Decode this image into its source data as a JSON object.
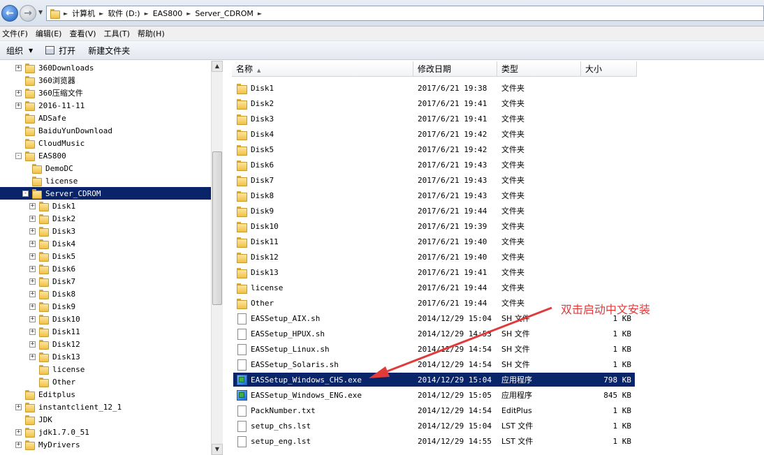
{
  "address": {
    "crumbs": [
      "计算机",
      "软件 (D:)",
      "EAS800",
      "Server_CDROM"
    ],
    "icons": {
      "back": "back-arrow-icon",
      "forward": "forward-arrow-icon"
    }
  },
  "menu": [
    "文件(F)",
    "编辑(E)",
    "查看(V)",
    "工具(T)",
    "帮助(H)"
  ],
  "toolbar": {
    "organize": "组织",
    "open": "打开",
    "new_folder": "新建文件夹"
  },
  "tree": {
    "items": [
      {
        "label": "360Downloads",
        "expander": "+",
        "level": 0
      },
      {
        "label": "360浏览器",
        "expander": "",
        "level": 0
      },
      {
        "label": "360压缩文件",
        "expander": "+",
        "level": 0
      },
      {
        "label": "2016-11-11",
        "expander": "+",
        "level": 0
      },
      {
        "label": "ADSafe",
        "expander": "",
        "level": 0
      },
      {
        "label": "BaiduYunDownload",
        "expander": "",
        "level": 0
      },
      {
        "label": "CloudMusic",
        "expander": "",
        "level": 0
      },
      {
        "label": "EAS800",
        "expander": "-",
        "level": 0
      },
      {
        "label": "DemoDC",
        "expander": "",
        "level": 1
      },
      {
        "label": "license",
        "expander": "",
        "level": 1
      },
      {
        "label": "Server_CDROM",
        "expander": "-",
        "level": 1,
        "selected": true
      },
      {
        "label": "Disk1",
        "expander": "+",
        "level": 2
      },
      {
        "label": "Disk2",
        "expander": "+",
        "level": 2
      },
      {
        "label": "Disk3",
        "expander": "+",
        "level": 2
      },
      {
        "label": "Disk4",
        "expander": "+",
        "level": 2
      },
      {
        "label": "Disk5",
        "expander": "+",
        "level": 2
      },
      {
        "label": "Disk6",
        "expander": "+",
        "level": 2
      },
      {
        "label": "Disk7",
        "expander": "+",
        "level": 2
      },
      {
        "label": "Disk8",
        "expander": "+",
        "level": 2
      },
      {
        "label": "Disk9",
        "expander": "+",
        "level": 2
      },
      {
        "label": "Disk10",
        "expander": "+",
        "level": 2
      },
      {
        "label": "Disk11",
        "expander": "+",
        "level": 2
      },
      {
        "label": "Disk12",
        "expander": "+",
        "level": 2
      },
      {
        "label": "Disk13",
        "expander": "+",
        "level": 2
      },
      {
        "label": "license",
        "expander": "",
        "level": 2
      },
      {
        "label": "Other",
        "expander": "",
        "level": 2
      },
      {
        "label": "Editplus",
        "expander": "",
        "level": 0
      },
      {
        "label": "instantclient_12_1",
        "expander": "+",
        "level": 0
      },
      {
        "label": "JDK",
        "expander": "",
        "level": 0
      },
      {
        "label": "jdk1.7.0_51",
        "expander": "+",
        "level": 0
      },
      {
        "label": "MyDrivers",
        "expander": "+",
        "level": 0
      }
    ]
  },
  "columns": {
    "name": "名称",
    "date": "修改日期",
    "type": "类型",
    "size": "大小"
  },
  "files": [
    {
      "name": "Disk1",
      "date": "2017/6/21 19:38",
      "type": "文件夹",
      "size": "",
      "icon": "folder-icon"
    },
    {
      "name": "Disk2",
      "date": "2017/6/21 19:41",
      "type": "文件夹",
      "size": "",
      "icon": "folder-icon"
    },
    {
      "name": "Disk3",
      "date": "2017/6/21 19:41",
      "type": "文件夹",
      "size": "",
      "icon": "folder-icon"
    },
    {
      "name": "Disk4",
      "date": "2017/6/21 19:42",
      "type": "文件夹",
      "size": "",
      "icon": "folder-icon"
    },
    {
      "name": "Disk5",
      "date": "2017/6/21 19:42",
      "type": "文件夹",
      "size": "",
      "icon": "folder-icon"
    },
    {
      "name": "Disk6",
      "date": "2017/6/21 19:43",
      "type": "文件夹",
      "size": "",
      "icon": "folder-icon"
    },
    {
      "name": "Disk7",
      "date": "2017/6/21 19:43",
      "type": "文件夹",
      "size": "",
      "icon": "folder-icon"
    },
    {
      "name": "Disk8",
      "date": "2017/6/21 19:43",
      "type": "文件夹",
      "size": "",
      "icon": "folder-icon"
    },
    {
      "name": "Disk9",
      "date": "2017/6/21 19:44",
      "type": "文件夹",
      "size": "",
      "icon": "folder-icon"
    },
    {
      "name": "Disk10",
      "date": "2017/6/21 19:39",
      "type": "文件夹",
      "size": "",
      "icon": "folder-icon"
    },
    {
      "name": "Disk11",
      "date": "2017/6/21 19:40",
      "type": "文件夹",
      "size": "",
      "icon": "folder-icon"
    },
    {
      "name": "Disk12",
      "date": "2017/6/21 19:40",
      "type": "文件夹",
      "size": "",
      "icon": "folder-icon"
    },
    {
      "name": "Disk13",
      "date": "2017/6/21 19:41",
      "type": "文件夹",
      "size": "",
      "icon": "folder-icon"
    },
    {
      "name": "license",
      "date": "2017/6/21 19:44",
      "type": "文件夹",
      "size": "",
      "icon": "folder-icon"
    },
    {
      "name": "Other",
      "date": "2017/6/21 19:44",
      "type": "文件夹",
      "size": "",
      "icon": "folder-icon"
    },
    {
      "name": "EASSetup_AIX.sh",
      "date": "2014/12/29 15:04",
      "type": "SH 文件",
      "size": "1 KB",
      "icon": "document-icon"
    },
    {
      "name": "EASSetup_HPUX.sh",
      "date": "2014/12/29 14:53",
      "type": "SH 文件",
      "size": "1 KB",
      "icon": "document-icon"
    },
    {
      "name": "EASSetup_Linux.sh",
      "date": "2014/12/29 14:54",
      "type": "SH 文件",
      "size": "1 KB",
      "icon": "document-icon"
    },
    {
      "name": "EASSetup_Solaris.sh",
      "date": "2014/12/29 14:54",
      "type": "SH 文件",
      "size": "1 KB",
      "icon": "document-icon"
    },
    {
      "name": "EASSetup_Windows_CHS.exe",
      "date": "2014/12/29 15:04",
      "type": "应用程序",
      "size": "798 KB",
      "icon": "setup-exe-icon",
      "selected": true
    },
    {
      "name": "EASSetup_Windows_ENG.exe",
      "date": "2014/12/29 15:05",
      "type": "应用程序",
      "size": "845 KB",
      "icon": "setup-exe-icon"
    },
    {
      "name": "PackNumber.txt",
      "date": "2014/12/29 14:54",
      "type": "EditPlus",
      "size": "1 KB",
      "icon": "document-icon"
    },
    {
      "name": "setup_chs.lst",
      "date": "2014/12/29 15:04",
      "type": "LST 文件",
      "size": "1 KB",
      "icon": "document-icon"
    },
    {
      "name": "setup_eng.lst",
      "date": "2014/12/29 14:55",
      "type": "LST 文件",
      "size": "1 KB",
      "icon": "document-icon"
    }
  ],
  "annotation": {
    "text": "双击启动中文安装",
    "color": "#e03a3a"
  }
}
